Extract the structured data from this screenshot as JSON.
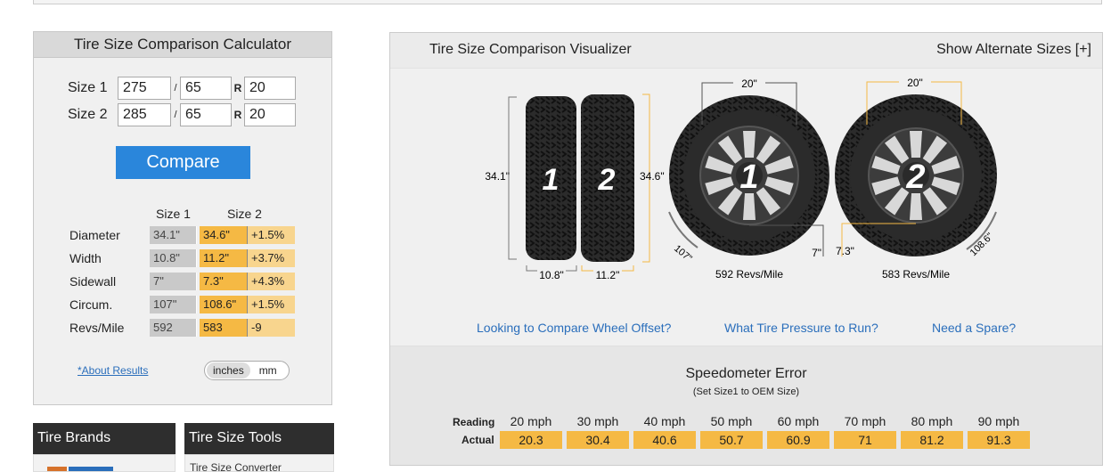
{
  "calculator": {
    "title": "Tire Size Comparison Calculator",
    "size1": {
      "label": "Size 1",
      "width": "275",
      "aspect": "65",
      "rim": "20"
    },
    "size2": {
      "label": "Size 2",
      "width": "285",
      "aspect": "65",
      "rim": "20"
    },
    "slash": "/",
    "r_label": "R",
    "compare_button": "Compare",
    "results_header": {
      "size1": "Size 1",
      "size2": "Size 2"
    },
    "results": [
      {
        "label": "Diameter",
        "s1": "34.1\"",
        "s2": "34.6\"",
        "diff": "+1.5%"
      },
      {
        "label": "Width",
        "s1": "10.8\"",
        "s2": "11.2\"",
        "diff": "+3.7%"
      },
      {
        "label": "Sidewall",
        "s1": "7\"",
        "s2": "7.3\"",
        "diff": "+4.3%"
      },
      {
        "label": "Circum.",
        "s1": "107\"",
        "s2": "108.6\"",
        "diff": "+1.5%"
      },
      {
        "label": "Revs/Mile",
        "s1": "592",
        "s2": "583",
        "diff": "-9"
      }
    ],
    "about_link": "*About Results",
    "units": {
      "on": "inches",
      "off": "mm"
    }
  },
  "bottom_boxes": {
    "brands": {
      "title": "Tire Brands",
      "item": ""
    },
    "tools": {
      "title": "Tire Size Tools",
      "item": "Tire Size Converter"
    }
  },
  "visualizer": {
    "title": "Tire Size Comparison Visualizer",
    "alternate": "Show Alternate Sizes [+]",
    "side_view": {
      "tire1_number": "1",
      "tire2_number": "2",
      "height1": "34.1\"",
      "height2": "34.6\"",
      "width1": "10.8\"",
      "width2": "11.2\""
    },
    "wheel1": {
      "number": "1",
      "rim": "20\"",
      "sidewall": "7\"",
      "circ": "107\"",
      "revs": "592 Revs/Mile"
    },
    "wheel2": {
      "number": "2",
      "rim": "20\"",
      "sidewall": "7.3\"",
      "circ": "108.6\"",
      "revs": "583 Revs/Mile"
    },
    "links": [
      "Looking to Compare Wheel Offset?",
      "What Tire Pressure to Run?",
      "Need a Spare?"
    ],
    "colors": {
      "size1": "#c9c9c9",
      "size2": "#f5b944",
      "link": "#2a6ebb",
      "button": "#2a86db"
    }
  },
  "speedometer": {
    "title": "Speedometer Error",
    "subtitle": "(Set Size1 to OEM Size)",
    "reading_label": "Reading",
    "actual_label": "Actual",
    "readings": [
      "20 mph",
      "30 mph",
      "40 mph",
      "50 mph",
      "60 mph",
      "70 mph",
      "80 mph",
      "90 mph"
    ],
    "actuals": [
      "20.3",
      "30.4",
      "40.6",
      "50.7",
      "60.9",
      "71",
      "81.2",
      "91.3"
    ]
  }
}
